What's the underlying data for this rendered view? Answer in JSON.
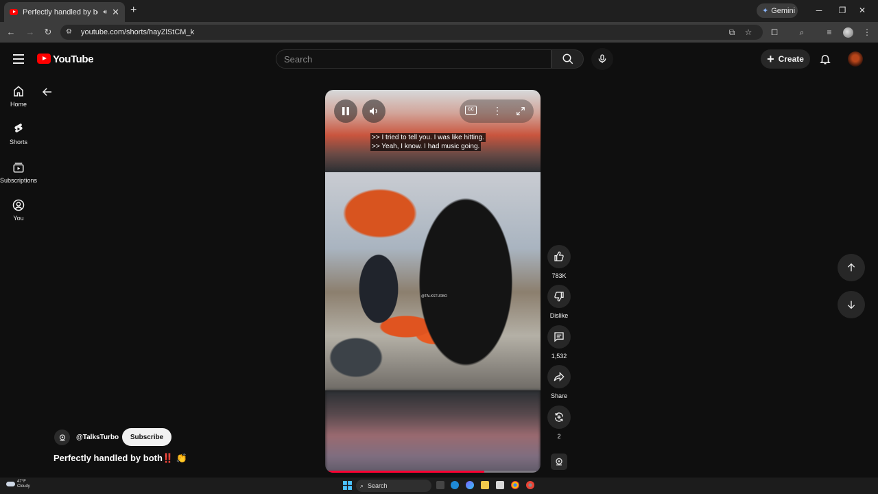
{
  "browser": {
    "tab_title": "Perfectly handled by both‼️ 👏",
    "gemini_label": "Gemini",
    "url": "youtube.com/shorts/hayZlStCM_k"
  },
  "youtube": {
    "logo_text": "YouTube",
    "search_placeholder": "Search",
    "create_label": "Create"
  },
  "sidebar": {
    "items": [
      {
        "label": "Home",
        "icon": "home-icon"
      },
      {
        "label": "Shorts",
        "icon": "shorts-icon"
      },
      {
        "label": "Subscriptions",
        "icon": "subscriptions-icon"
      },
      {
        "label": "You",
        "icon": "you-icon"
      }
    ]
  },
  "video": {
    "captions": [
      ">> I tried to tell you. I was like hitting.",
      ">> Yeah, I know. I had music going."
    ],
    "watermark": "@TALKSTURBO",
    "progress": 0.75
  },
  "actions": {
    "likes": "783K",
    "dislike_label": "Dislike",
    "comments": "1,532",
    "share_label": "Share",
    "remix_count": "2"
  },
  "channel": {
    "handle": "@TalksTurbo",
    "subscribe_label": "Subscribe"
  },
  "short_title": "Perfectly handled by both‼️ 👏",
  "taskbar": {
    "temperature": "47°F",
    "condition": "Cloudy",
    "search_label": "Search"
  },
  "colors": {
    "accent": "#ff0000",
    "progress": "#ff0033",
    "background": "#0f0f0f"
  }
}
